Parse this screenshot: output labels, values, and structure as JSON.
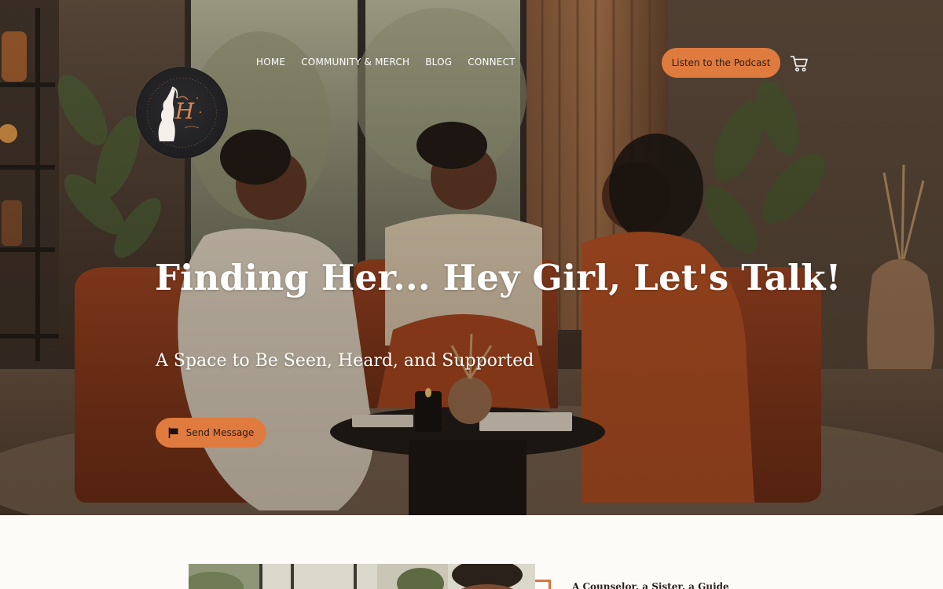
{
  "nav": {
    "links": [
      {
        "label": "HOME"
      },
      {
        "label": "COMMUNITY & MERCH"
      },
      {
        "label": "BLOG"
      },
      {
        "label": "CONNECT"
      }
    ],
    "cta_label": "Listen to the Podcast",
    "cart_icon": "cart-icon"
  },
  "logo": {
    "icon": "silhouette-monogram-logo",
    "monogram": "H"
  },
  "hero": {
    "title": "Finding Her... Hey Girl, Let's Talk!",
    "subtitle": "A Space to Be Seen, Heard, and Supported",
    "button_label": "Send Message",
    "button_icon": "message-flag-icon"
  },
  "about": {
    "heading": "A Counselor, a Sister, a Guide"
  },
  "colors": {
    "accent": "#e07b3f",
    "text_dark": "#2a1d14",
    "hero_overlay": "#3a2c22",
    "section_bg": "#fdfbf8"
  }
}
